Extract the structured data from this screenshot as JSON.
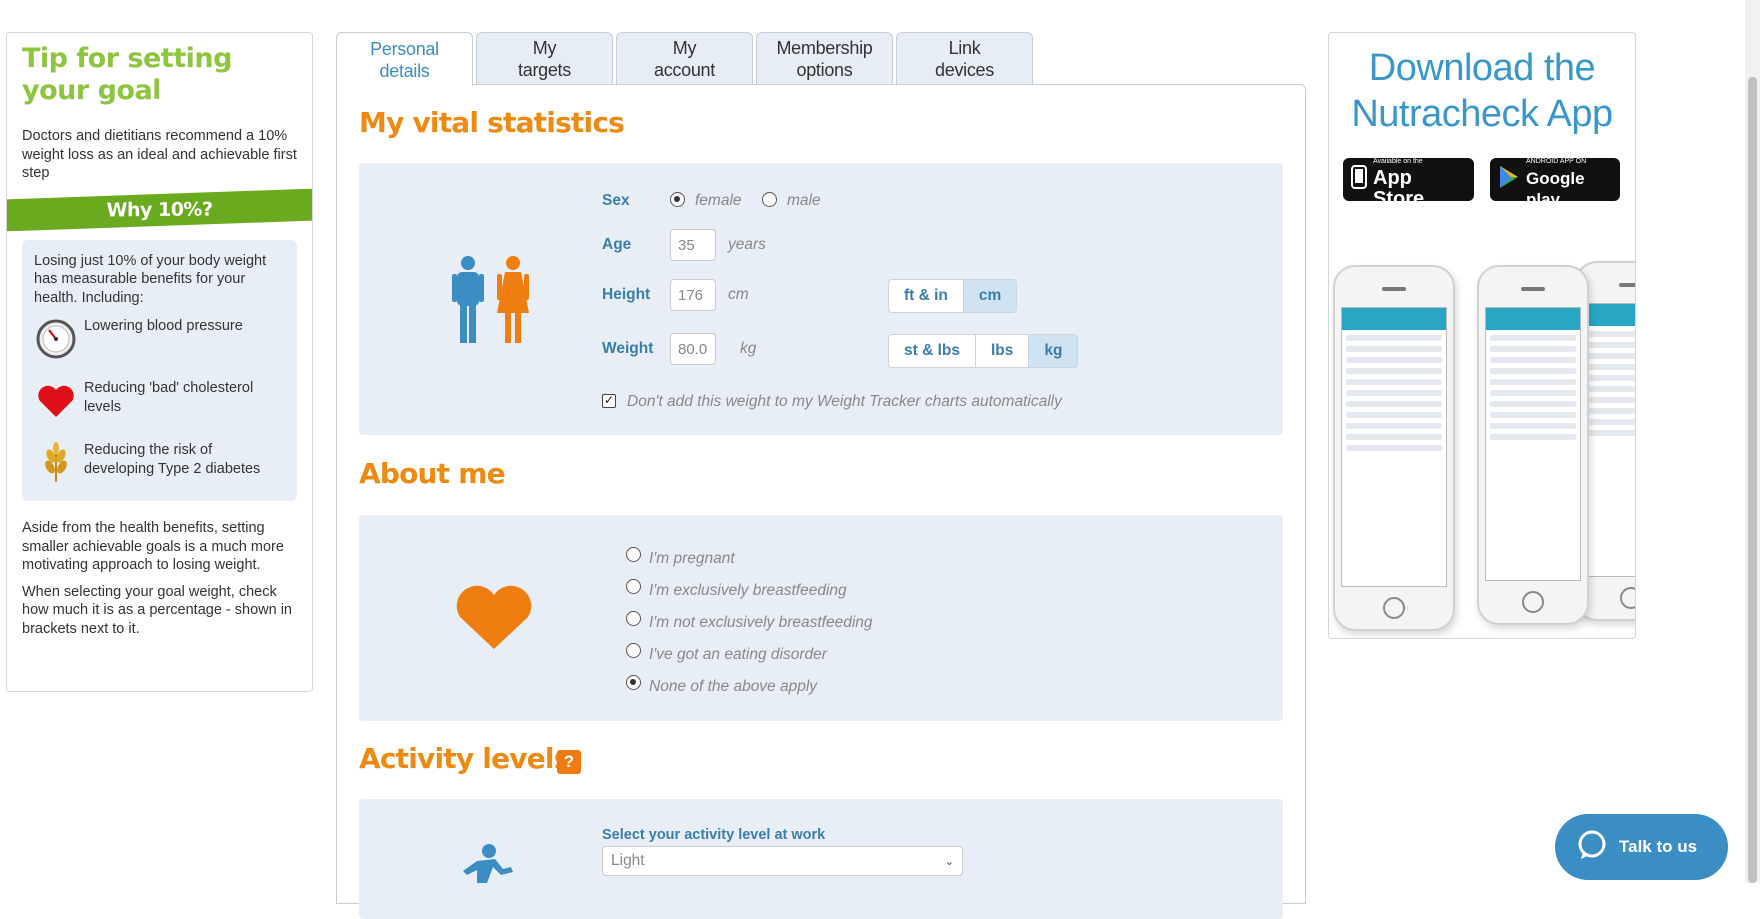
{
  "tip": {
    "title": "Tip for setting your goal",
    "intro": "Doctors and dietitians recommend a 10% weight loss as an ideal and achievable first step",
    "banner": "Why 10%?",
    "box_intro": "Losing just 10% of your body weight has measurable benefits for your health. Including:",
    "benefits": [
      {
        "icon": "blood-pressure-gauge-icon",
        "text": "Lowering blood pressure"
      },
      {
        "icon": "heart-icon",
        "text": "Reducing 'bad' cholesterol levels"
      },
      {
        "icon": "wheat-icon",
        "text": "Reducing the risk of developing Type 2 diabetes"
      }
    ],
    "outro_1": "Aside from the health benefits, setting smaller achievable goals is a much more motivating approach to losing weight.",
    "outro_2": "When selecting your goal weight, check how much it is as a percentage - shown in brackets next to it."
  },
  "tabs": [
    {
      "line1": "Personal",
      "line2": "details",
      "active": true
    },
    {
      "line1": "My",
      "line2": "targets",
      "active": false
    },
    {
      "line1": "My",
      "line2": "account",
      "active": false
    },
    {
      "line1": "Membership",
      "line2": "options",
      "active": false
    },
    {
      "line1": "Link",
      "line2": "devices",
      "active": false
    }
  ],
  "vitals": {
    "title": "My vital statistics",
    "sex_label": "Sex",
    "sex_options": [
      "female",
      "male"
    ],
    "sex_selected": "female",
    "age_label": "Age",
    "age_value": "35",
    "age_unit": "years",
    "height_label": "Height",
    "height_value": "176",
    "height_unit": "cm",
    "height_units": [
      "ft & in",
      "cm"
    ],
    "height_selected": "cm",
    "weight_label": "Weight",
    "weight_value": "80.0",
    "weight_unit": "kg",
    "weight_units": [
      "st & lbs",
      "lbs",
      "kg"
    ],
    "weight_selected": "kg",
    "tracker_checkbox_label": "Don't add this weight to my Weight Tracker charts automatically",
    "tracker_checked": true
  },
  "about": {
    "title": "About me",
    "options": [
      "I'm pregnant",
      "I'm exclusively breastfeeding",
      "I'm not exclusively breastfeeding",
      "I've got an eating disorder",
      "None of the above apply"
    ],
    "selected": "None of the above apply"
  },
  "activity": {
    "title": "Activity levels",
    "help": "?",
    "work_label": "Select your activity level at work",
    "work_value": "Light"
  },
  "app_ad": {
    "title_line1": "Download the",
    "title_line2": "Nutracheck App",
    "appstore_small": "Available on the",
    "appstore_big": "App Store",
    "googleplay_small": "ANDROID APP ON",
    "googleplay_big": "Google play"
  },
  "chat": {
    "label": "Talk to us"
  },
  "colors": {
    "accent_orange": "#ee8a10",
    "accent_blue": "#3a8ec4",
    "tip_green": "#8cc63f",
    "banner_green": "#6aaa1e"
  }
}
